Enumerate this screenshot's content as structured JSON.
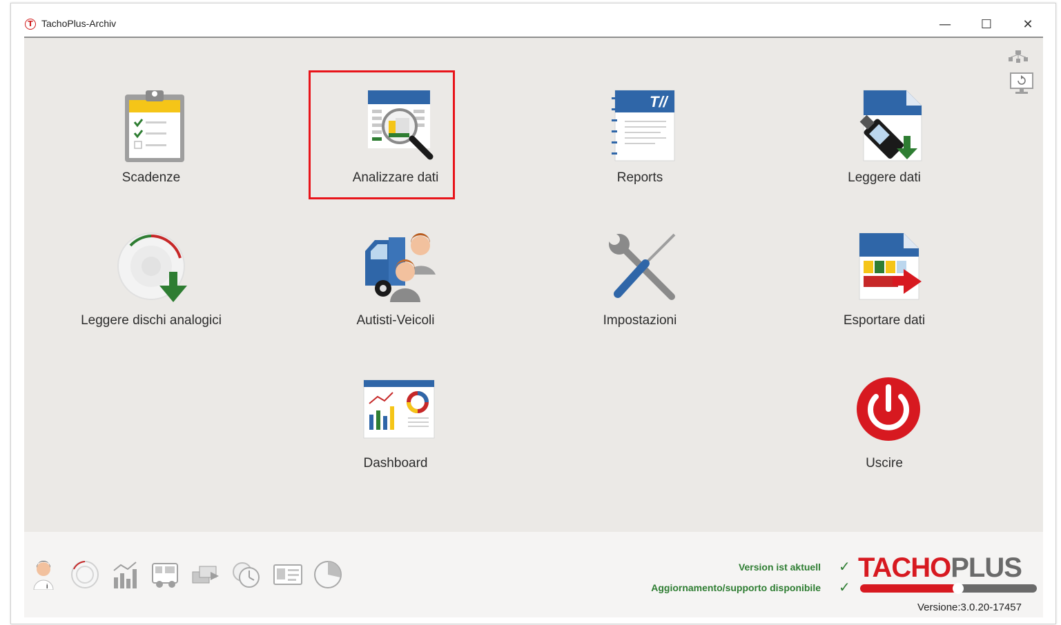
{
  "window": {
    "title": "TachoPlus-Archiv",
    "app_icon_letter": "T",
    "controls": {
      "minimize": "—",
      "maximize": "☐",
      "close": "✕"
    }
  },
  "tiles": [
    {
      "id": "scadenze",
      "label": "Scadenze",
      "icon": "clipboard-checklist-icon"
    },
    {
      "id": "analizzare",
      "label": "Analizzare dati",
      "icon": "calendar-magnifier-icon",
      "highlighted": true
    },
    {
      "id": "reports",
      "label": "Reports",
      "icon": "report-notebook-icon"
    },
    {
      "id": "leggere",
      "label": "Leggere dati",
      "icon": "card-reader-download-icon"
    },
    {
      "id": "dischi",
      "label": "Leggere dischi analogici",
      "icon": "analog-disc-download-icon"
    },
    {
      "id": "autisti",
      "label": "Autisti-Veicoli",
      "icon": "truck-drivers-icon"
    },
    {
      "id": "impostazioni",
      "label": "Impostazioni",
      "icon": "wrench-screwdriver-icon"
    },
    {
      "id": "esportare",
      "label": "Esportare dati",
      "icon": "file-export-icon"
    },
    {
      "id": "dashboard",
      "label": "Dashboard",
      "icon": "dashboard-charts-icon"
    },
    {
      "id": "uscire",
      "label": "Uscire",
      "icon": "power-icon"
    }
  ],
  "side_icons": [
    "network-icon",
    "monitor-refresh-icon"
  ],
  "footer": {
    "shortcuts": [
      "driver-icon",
      "disc-icon",
      "statistics-icon",
      "vehicle-icon",
      "exchange-icon",
      "clock-icon",
      "id-card-icon",
      "pie-chart-icon"
    ],
    "status_version": "Version ist aktuell",
    "status_support": "Aggiornamento/supporto disponibile",
    "check": "✓",
    "brand_red": "TACHO",
    "brand_gray": "PLUS",
    "version": "Versione:3.0.20-17457"
  },
  "colors": {
    "accent_red": "#d71920",
    "status_green": "#2e7d32",
    "content_bg": "#ebe9e6",
    "icon_blue": "#2f66a8"
  }
}
